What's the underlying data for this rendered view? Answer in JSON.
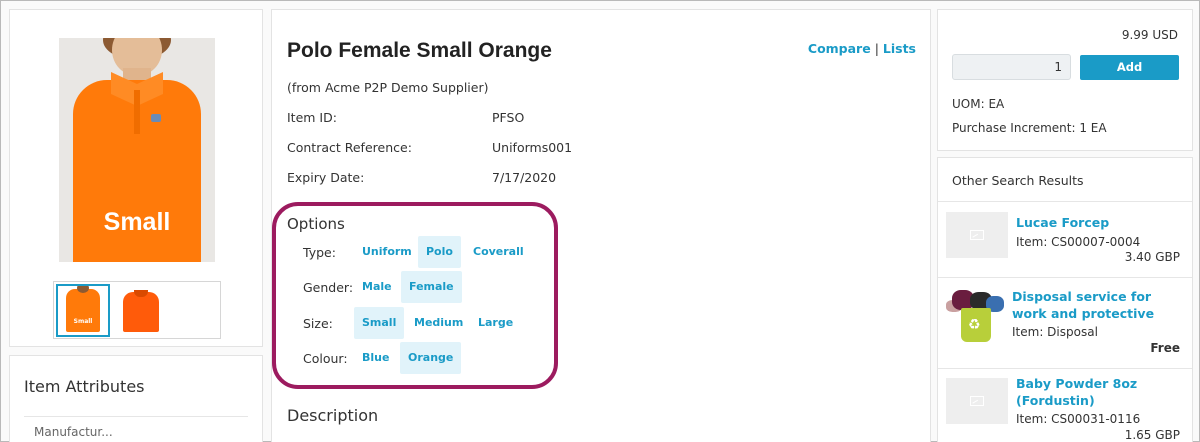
{
  "product": {
    "title": "Polo Female Small Orange",
    "supplier": "(from Acme P2P Demo Supplier)",
    "image_overlay_text": "Small",
    "thumb_overlay_text": "Small",
    "compare_label": "Compare",
    "separator": "|",
    "lists_label": "Lists",
    "fields": [
      {
        "label": "Item ID:",
        "value": "PFSO"
      },
      {
        "label": "Contract Reference:",
        "value": "Uniforms001"
      },
      {
        "label": "Expiry Date:",
        "value": "7/17/2020"
      }
    ]
  },
  "options": {
    "title": "Options",
    "groups": [
      {
        "label": "Type:",
        "choices": [
          "Uniform",
          "Polo",
          "Coverall"
        ],
        "selected": "Polo"
      },
      {
        "label": "Gender:",
        "choices": [
          "Male",
          "Female"
        ],
        "selected": "Female"
      },
      {
        "label": "Size:",
        "choices": [
          "Small",
          "Medium",
          "Large"
        ],
        "selected": "Small"
      },
      {
        "label": "Colour:",
        "choices": [
          "Blue",
          "Orange"
        ],
        "selected": "Orange"
      }
    ]
  },
  "description_title": "Description",
  "attributes": {
    "title": "Item Attributes",
    "first_row": "Manufactur..."
  },
  "purchase": {
    "price": "9.99 USD",
    "quantity": "1",
    "add_label": "Add",
    "uom": "UOM: EA",
    "increment": "Purchase Increment: 1 EA"
  },
  "other_results": {
    "title": "Other Search Results",
    "items": [
      {
        "name": "Lucae Forcep",
        "id": "Item: CS00007-0004",
        "price": "3.40 GBP"
      },
      {
        "name": "Disposal service for work and protective wear, shoes",
        "id": "Item: Disposal",
        "price": "Free"
      },
      {
        "name": "Baby Powder 8oz (Fordustin)",
        "id": "Item: CS00031-0116",
        "price": "1.65 GBP"
      }
    ]
  },
  "colors": {
    "accent": "#1a9bc7",
    "highlight": "#9c1b5f",
    "shirt": "#ff7a0a"
  }
}
